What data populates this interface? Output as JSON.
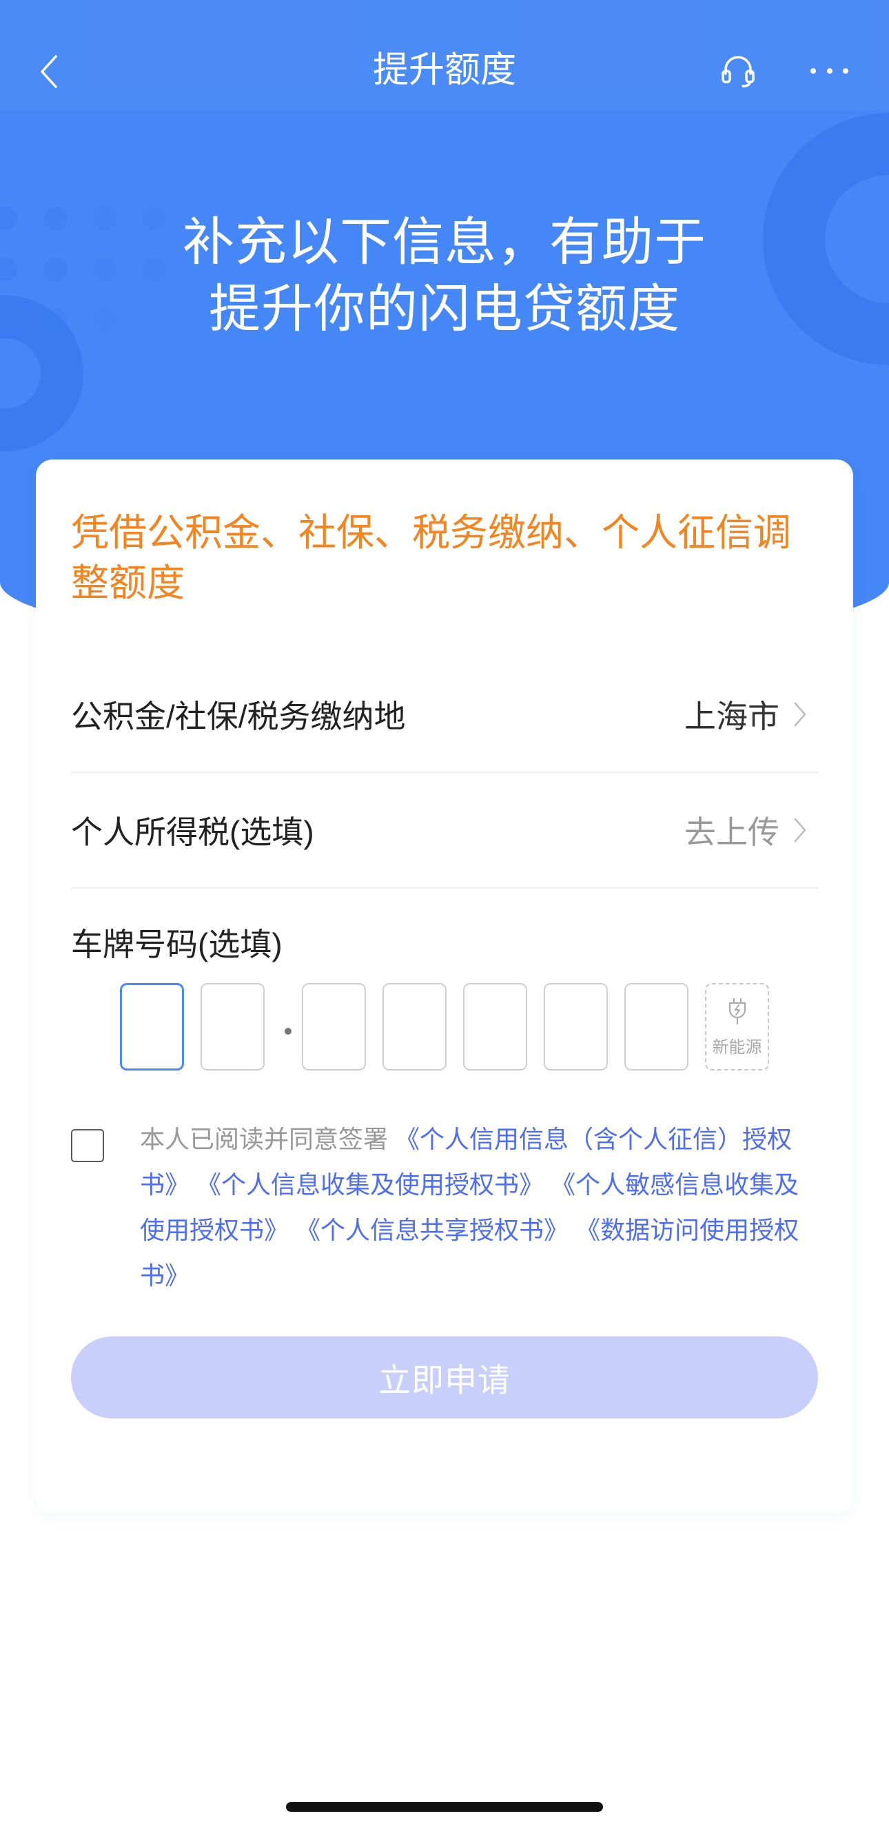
{
  "nav": {
    "title": "提升额度",
    "back_icon": "chevron-left-icon",
    "support_icon": "headset-icon",
    "more_icon": "more-icon"
  },
  "hero": {
    "line1": "补充以下信息，有助于",
    "line2": "提升你的闪电贷额度"
  },
  "form": {
    "notice": "凭借公积金、社保、税务缴纳、个人征信调整额度",
    "rows": [
      {
        "label": "公积金/社保/税务缴纳地",
        "value": "上海市",
        "icon": "chevron-right-icon"
      },
      {
        "label": "个人所得税(选填)",
        "value": "去上传",
        "icon": "chevron-right-icon"
      }
    ],
    "plate": {
      "label": "车牌号码(选填)",
      "slots": [
        "",
        "",
        "",
        "",
        "",
        "",
        ""
      ],
      "new_energy": {
        "label": "新能源",
        "icon": "plug-icon"
      }
    },
    "agreement": {
      "checked": false,
      "prefix": "本人已阅读并同意签署",
      "documents": [
        "《个人信用信息（含个人征信）授权书》",
        "《个人信息收集及使用授权书》",
        "《个人敏感信息收集及使用授权书》",
        "《个人信息共享授权书》",
        "《数据访问使用授权书》"
      ]
    },
    "submit_label": "立即申请"
  },
  "colors": {
    "primary_blue": "#4587f6",
    "notice_orange": "#f5841f",
    "link_blue": "#4e6ef2",
    "submit_disabled": "#c7cffa"
  }
}
